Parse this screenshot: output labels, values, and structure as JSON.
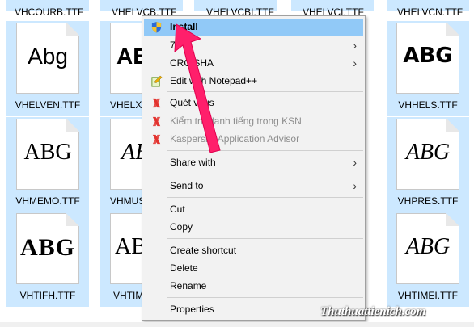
{
  "top_row_names": [
    "VHCOURB.TTF",
    "VHELVCB.TTF",
    "VHELVCBI.TTF",
    "VHELVCI.TTF",
    "VHELVCN.TTF"
  ],
  "tiles": [
    {
      "sample": "Abg",
      "label": "VHELVEN.TTF"
    },
    {
      "sample": "ABG",
      "label": "VHELXOT.TTF"
    },
    {
      "sample": "ABG",
      "label": "VHHELS.TTF"
    },
    {
      "sample": "ABG",
      "label": "VHMEMO.TTF"
    },
    {
      "sample": "ABG",
      "label": "VHMUSTR.TTF"
    },
    {
      "sample": "ABG",
      "label": "VHPRES.TTF"
    },
    {
      "sample": "ABG",
      "label": "VHTIFH.TTF"
    },
    {
      "sample": "AB",
      "label": "VHTIMEB.TTF"
    },
    {
      "sample": "ABG",
      "label": "VHTIMEI.TTF"
    }
  ],
  "menu": {
    "install": "Install",
    "sevenzip": "7-Zip",
    "crc": "CRC SHA",
    "edit_notepad": "Edit with Notepad++",
    "scan": "Quét virus",
    "ksn": "Kiểm tra danh tiếng trong KSN",
    "kaspersky_advisor": "Kaspersky Application Advisor",
    "share_with": "Share with",
    "send_to": "Send to",
    "cut": "Cut",
    "copy": "Copy",
    "create_shortcut": "Create shortcut",
    "delete": "Delete",
    "rename": "Rename",
    "properties": "Properties"
  },
  "watermark": "Thuthuattienich.com",
  "colors": {
    "selection": "#cce8ff",
    "menu_bg": "#f2f2f2",
    "arrow": "#ff1f6b"
  }
}
